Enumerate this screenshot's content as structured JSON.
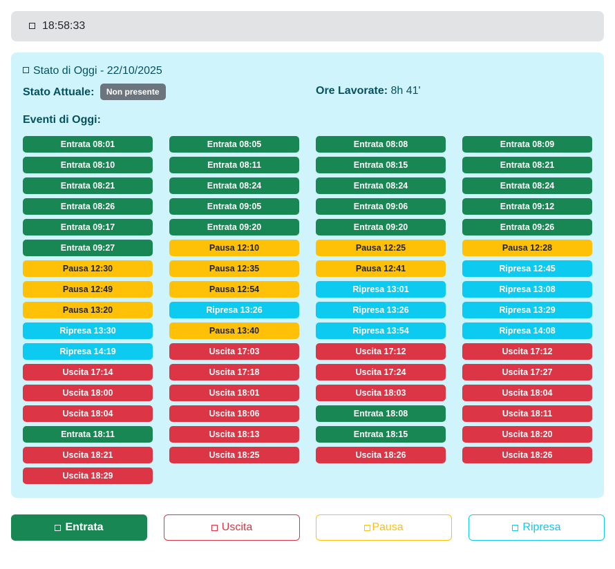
{
  "clock": {
    "icon": "clock-icon",
    "time": "18:58:33"
  },
  "panel": {
    "title": "Stato di Oggi - 22/10/2025",
    "title_icon": "calendar-icon",
    "stato_label": "Stato Attuale:",
    "stato_badge": "Non presente",
    "ore_label": "Ore Lavorate:",
    "ore_value": "8h 41'",
    "eventi_title": "Eventi di Oggi:"
  },
  "colors": {
    "entrata": "#198754",
    "pausa": "#ffc107",
    "ripresa": "#0dcaf0",
    "uscita": "#dc3545",
    "panel_bg": "#cff4fc",
    "badge": "#6c757d"
  },
  "events": [
    {
      "label": "Entrata 08:01",
      "type": "entrata"
    },
    {
      "label": "Entrata 08:05",
      "type": "entrata"
    },
    {
      "label": "Entrata 08:08",
      "type": "entrata"
    },
    {
      "label": "Entrata 08:09",
      "type": "entrata"
    },
    {
      "label": "Entrata 08:10",
      "type": "entrata"
    },
    {
      "label": "Entrata 08:11",
      "type": "entrata"
    },
    {
      "label": "Entrata 08:15",
      "type": "entrata"
    },
    {
      "label": "Entrata 08:21",
      "type": "entrata"
    },
    {
      "label": "Entrata 08:21",
      "type": "entrata"
    },
    {
      "label": "Entrata 08:24",
      "type": "entrata"
    },
    {
      "label": "Entrata 08:24",
      "type": "entrata"
    },
    {
      "label": "Entrata 08:24",
      "type": "entrata"
    },
    {
      "label": "Entrata 08:26",
      "type": "entrata"
    },
    {
      "label": "Entrata 09:05",
      "type": "entrata"
    },
    {
      "label": "Entrata 09:06",
      "type": "entrata"
    },
    {
      "label": "Entrata 09:12",
      "type": "entrata"
    },
    {
      "label": "Entrata 09:17",
      "type": "entrata"
    },
    {
      "label": "Entrata 09:20",
      "type": "entrata"
    },
    {
      "label": "Entrata 09:20",
      "type": "entrata"
    },
    {
      "label": "Entrata 09:26",
      "type": "entrata"
    },
    {
      "label": "Entrata 09:27",
      "type": "entrata"
    },
    {
      "label": "Pausa 12:10",
      "type": "pausa"
    },
    {
      "label": "Pausa 12:25",
      "type": "pausa"
    },
    {
      "label": "Pausa 12:28",
      "type": "pausa"
    },
    {
      "label": "Pausa 12:30",
      "type": "pausa"
    },
    {
      "label": "Pausa 12:35",
      "type": "pausa"
    },
    {
      "label": "Pausa 12:41",
      "type": "pausa"
    },
    {
      "label": "Ripresa 12:45",
      "type": "ripresa"
    },
    {
      "label": "Pausa 12:49",
      "type": "pausa"
    },
    {
      "label": "Pausa 12:54",
      "type": "pausa"
    },
    {
      "label": "Ripresa 13:01",
      "type": "ripresa"
    },
    {
      "label": "Ripresa 13:08",
      "type": "ripresa"
    },
    {
      "label": "Pausa 13:20",
      "type": "pausa"
    },
    {
      "label": "Ripresa 13:26",
      "type": "ripresa"
    },
    {
      "label": "Ripresa 13:26",
      "type": "ripresa"
    },
    {
      "label": "Ripresa 13:29",
      "type": "ripresa"
    },
    {
      "label": "Ripresa 13:30",
      "type": "ripresa"
    },
    {
      "label": "Pausa 13:40",
      "type": "pausa"
    },
    {
      "label": "Ripresa 13:54",
      "type": "ripresa"
    },
    {
      "label": "Ripresa 14:08",
      "type": "ripresa"
    },
    {
      "label": "Ripresa 14:19",
      "type": "ripresa"
    },
    {
      "label": "Uscita 17:03",
      "type": "uscita"
    },
    {
      "label": "Uscita 17:12",
      "type": "uscita"
    },
    {
      "label": "Uscita 17:12",
      "type": "uscita"
    },
    {
      "label": "Uscita 17:14",
      "type": "uscita"
    },
    {
      "label": "Uscita 17:18",
      "type": "uscita"
    },
    {
      "label": "Uscita 17:24",
      "type": "uscita"
    },
    {
      "label": "Uscita 17:27",
      "type": "uscita"
    },
    {
      "label": "Uscita 18:00",
      "type": "uscita"
    },
    {
      "label": "Uscita 18:01",
      "type": "uscita"
    },
    {
      "label": "Uscita 18:03",
      "type": "uscita"
    },
    {
      "label": "Uscita 18:04",
      "type": "uscita"
    },
    {
      "label": "Uscita 18:04",
      "type": "uscita"
    },
    {
      "label": "Uscita 18:06",
      "type": "uscita"
    },
    {
      "label": "Entrata 18:08",
      "type": "entrata"
    },
    {
      "label": "Uscita 18:11",
      "type": "uscita"
    },
    {
      "label": "Entrata 18:11",
      "type": "entrata"
    },
    {
      "label": "Uscita 18:13",
      "type": "uscita"
    },
    {
      "label": "Entrata 18:15",
      "type": "entrata"
    },
    {
      "label": "Uscita 18:20",
      "type": "uscita"
    },
    {
      "label": "Uscita 18:21",
      "type": "uscita"
    },
    {
      "label": "Uscita 18:25",
      "type": "uscita"
    },
    {
      "label": "Uscita 18:26",
      "type": "uscita"
    },
    {
      "label": "Uscita 18:26",
      "type": "uscita"
    },
    {
      "label": "Uscita 18:29",
      "type": "uscita"
    }
  ],
  "actions": {
    "entrata": {
      "label": "Entrata",
      "icon": "login-icon"
    },
    "uscita": {
      "label": "Uscita",
      "icon": "logout-icon"
    },
    "pausa": {
      "label": "Pausa",
      "icon": "pause-icon"
    },
    "ripresa": {
      "label": "Ripresa",
      "icon": "play-icon"
    }
  }
}
